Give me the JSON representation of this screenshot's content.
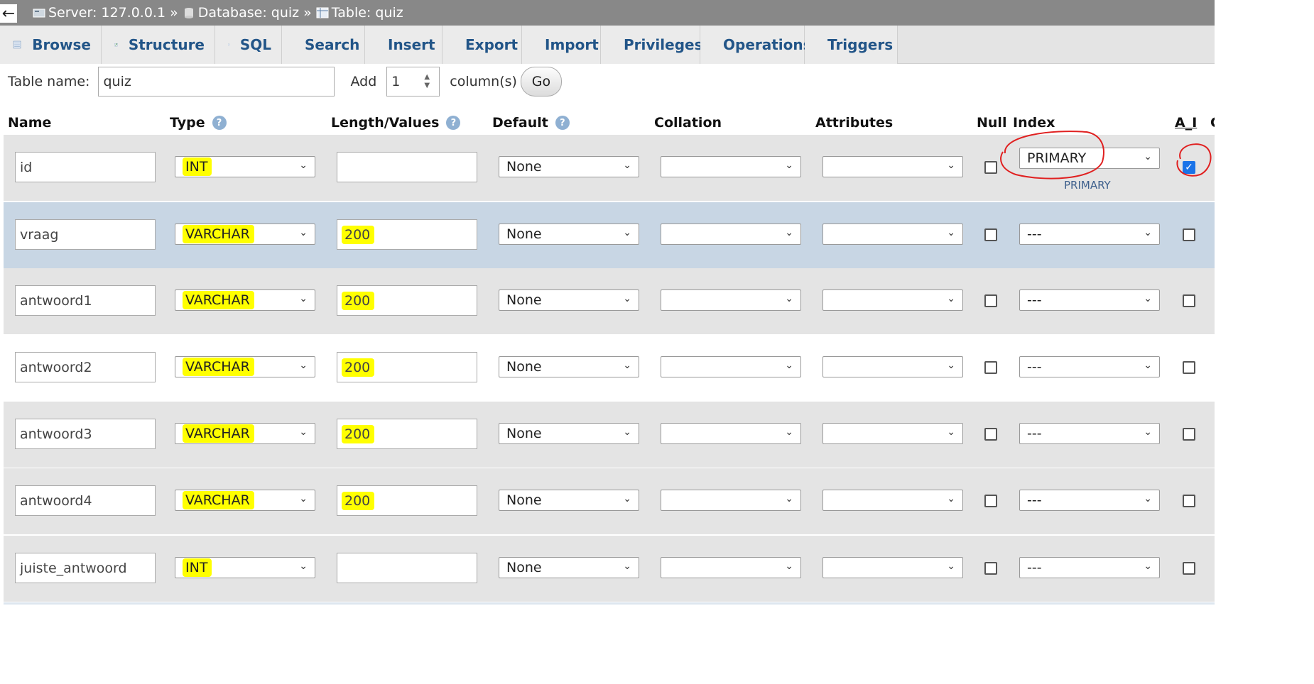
{
  "breadcrumb": {
    "back": "←",
    "server": "Server: 127.0.0.1",
    "database": "Database: quiz",
    "table": "Table: quiz",
    "sep": "»"
  },
  "tabs": [
    {
      "label": "Browse",
      "icon": "browse-icon"
    },
    {
      "label": "Structure",
      "icon": "structure-icon"
    },
    {
      "label": "SQL",
      "icon": "sql-icon"
    },
    {
      "label": "Search",
      "icon": "search-icon"
    },
    {
      "label": "Insert",
      "icon": "insert-icon"
    },
    {
      "label": "Export",
      "icon": "export-icon"
    },
    {
      "label": "Import",
      "icon": "import-icon"
    },
    {
      "label": "Privileges",
      "icon": "privileges-icon"
    },
    {
      "label": "Operations",
      "icon": "operations-icon"
    },
    {
      "label": "Triggers",
      "icon": "triggers-icon"
    }
  ],
  "namebar": {
    "table_name_label": "Table name:",
    "table_name_value": "quiz",
    "add_label": "Add",
    "add_value": "1",
    "columns_label": "column(s)",
    "go_label": "Go"
  },
  "headers": {
    "name": "Name",
    "type": "Type",
    "length": "Length/Values",
    "default": "Default",
    "collation": "Collation",
    "attributes": "Attributes",
    "null": "Null",
    "index": "Index",
    "ai": "A_I",
    "cut": "C"
  },
  "rows": [
    {
      "name": "id",
      "type": "INT",
      "length": "",
      "default": "None",
      "index": "PRIMARY",
      "index_sub": "PRIMARY",
      "ai_checked": true
    },
    {
      "name": "vraag",
      "type": "VARCHAR",
      "length": "200",
      "default": "None",
      "index": "---",
      "index_sub": "",
      "ai_checked": false
    },
    {
      "name": "antwoord1",
      "type": "VARCHAR",
      "length": "200",
      "default": "None",
      "index": "---",
      "index_sub": "",
      "ai_checked": false
    },
    {
      "name": "antwoord2",
      "type": "VARCHAR",
      "length": "200",
      "default": "None",
      "index": "---",
      "index_sub": "",
      "ai_checked": false
    },
    {
      "name": "antwoord3",
      "type": "VARCHAR",
      "length": "200",
      "default": "None",
      "index": "---",
      "index_sub": "",
      "ai_checked": false
    },
    {
      "name": "antwoord4",
      "type": "VARCHAR",
      "length": "200",
      "default": "None",
      "index": "---",
      "index_sub": "",
      "ai_checked": false
    },
    {
      "name": "juiste_antwoord",
      "type": "INT",
      "length": "",
      "default": "None",
      "index": "---",
      "index_sub": "",
      "ai_checked": false
    }
  ],
  "colors": {
    "tab_text": "#225588",
    "row_gray": "#e4e4e4",
    "row_highlight": "#c8d6e4",
    "highlighter": "#ffff00",
    "annotation": "#e02020"
  }
}
